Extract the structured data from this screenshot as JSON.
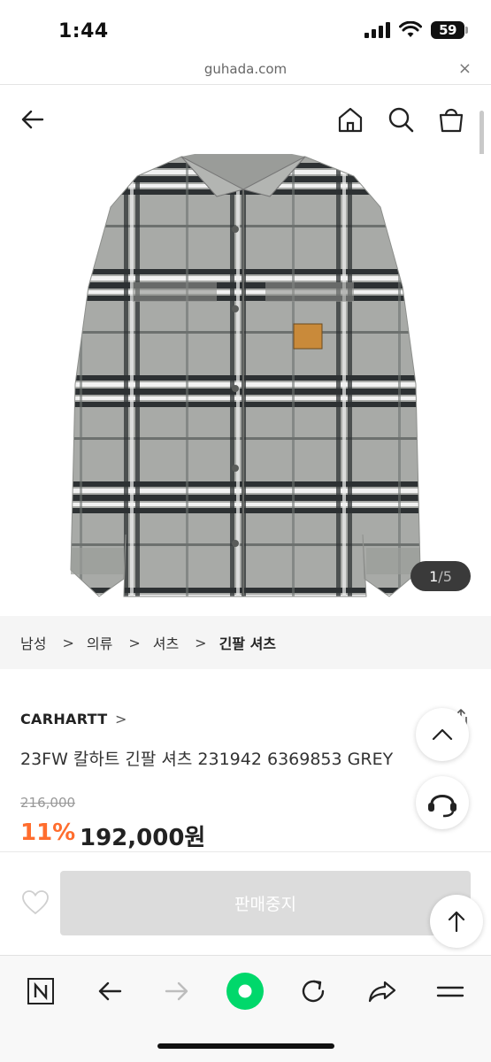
{
  "status_bar": {
    "time": "1:44",
    "battery": "59"
  },
  "browser": {
    "url": "guhada.com",
    "close_label": "×"
  },
  "header": {
    "back_icon": "arrow-left-icon",
    "home_icon": "home-icon",
    "search_icon": "search-icon",
    "cart_icon": "shopping-bag-icon"
  },
  "gallery": {
    "current": "1",
    "total": "/5"
  },
  "breadcrumb": {
    "items": [
      "남성",
      "의류",
      "셔츠"
    ],
    "current": "긴팔 셔츠",
    "separator": ">"
  },
  "product": {
    "brand": "CARHARTT",
    "brand_chevron": ">",
    "title": "23FW 칼하트 긴팔 셔츠 231942 6369853 GREY",
    "original_price": "216,000",
    "discount": "11%",
    "price": "192,000원"
  },
  "actions": {
    "status_button": "판매중지",
    "wishlist_icon": "heart-icon"
  },
  "colors": {
    "accent": "#ff6d2e",
    "disabled_button": "#dcdcdc",
    "live_button": "#00d86b"
  }
}
